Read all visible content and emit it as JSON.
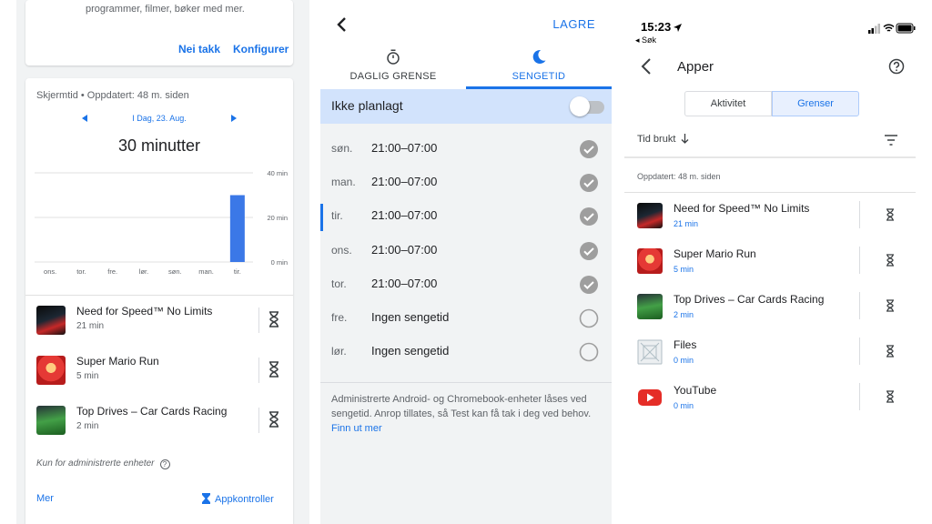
{
  "panel1": {
    "top_card": {
      "description": "programmer, filmer, bøker med mer.",
      "decline_label": "Nei takk",
      "configure_label": "Konfigurer"
    },
    "screen_time": {
      "header": "Skjermtid • Oppdatert: 48 m. siden",
      "date_label": "I Dag, 23. Aug.",
      "total": "30 minutter"
    },
    "chart_data": {
      "type": "bar",
      "categories": [
        "ons.",
        "tor.",
        "fre.",
        "lør.",
        "søn.",
        "man.",
        "tir."
      ],
      "values": [
        0,
        0,
        0,
        0,
        0,
        0,
        30
      ],
      "y_ticks": [
        "0 min",
        "20 min",
        "40 min"
      ],
      "ylim": [
        0,
        40
      ],
      "bar_color": "#3b78e7"
    },
    "apps": [
      {
        "name": "Need for Speed™ No Limits",
        "time": "21 min",
        "icon": "nfs-app-icon"
      },
      {
        "name": "Super Mario Run",
        "time": "5 min",
        "icon": "mario-app-icon"
      },
      {
        "name": "Top Drives – Car Cards Racing",
        "time": "2 min",
        "icon": "top-drives-app-icon"
      }
    ],
    "note": "Kun for administrerte enheter",
    "more_label": "Mer",
    "app_controls_label": "Appkontroller"
  },
  "panel2": {
    "save_label": "LAGRE",
    "tabs": [
      {
        "label": "DAGLIG GRENSE",
        "icon": "timer-icon"
      },
      {
        "label": "SENGETID",
        "icon": "moon-icon"
      }
    ],
    "plan_label": "Ikke planlagt",
    "days": [
      {
        "day": "søn.",
        "time": "21:00–07:00",
        "checked": true
      },
      {
        "day": "man.",
        "time": "21:00–07:00",
        "checked": true
      },
      {
        "day": "tir.",
        "time": "21:00–07:00",
        "checked": true
      },
      {
        "day": "ons.",
        "time": "21:00–07:00",
        "checked": true
      },
      {
        "day": "tor.",
        "time": "21:00–07:00",
        "checked": true
      },
      {
        "day": "fre.",
        "time": "Ingen sengetid",
        "checked": false
      },
      {
        "day": "lør.",
        "time": "Ingen sengetid",
        "checked": false
      }
    ],
    "info": "Administrerte Android- og Chromebook-enheter låses ved sengetid. Anrop tillates, så Test kan få tak i deg ved behov.",
    "learn_more": "Finn ut mer"
  },
  "panel3": {
    "status_time": "15:23",
    "back_app": "◂ Søk",
    "title": "Apper",
    "segments": [
      "Aktivitet",
      "Grenser"
    ],
    "sort_label": "Tid brukt",
    "updated": "Oppdatert: 48 m. siden",
    "apps": [
      {
        "name": "Need for Speed™ No Limits",
        "time": "21 min",
        "icon": "nfs-app-icon"
      },
      {
        "name": "Super Mario Run",
        "time": "5 min",
        "icon": "mario-app-icon"
      },
      {
        "name": "Top Drives – Car Cards Racing",
        "time": "2 min",
        "icon": "top-drives-app-icon"
      },
      {
        "name": "Files",
        "time": "0 min",
        "icon": "files-app-icon"
      },
      {
        "name": "YouTube",
        "time": "0 min",
        "icon": "youtube-app-icon"
      }
    ]
  },
  "colors": {
    "accent": "#1a73e8",
    "plan_bar": "#d2e3fc",
    "panel_bg": "#f1f3f4"
  }
}
